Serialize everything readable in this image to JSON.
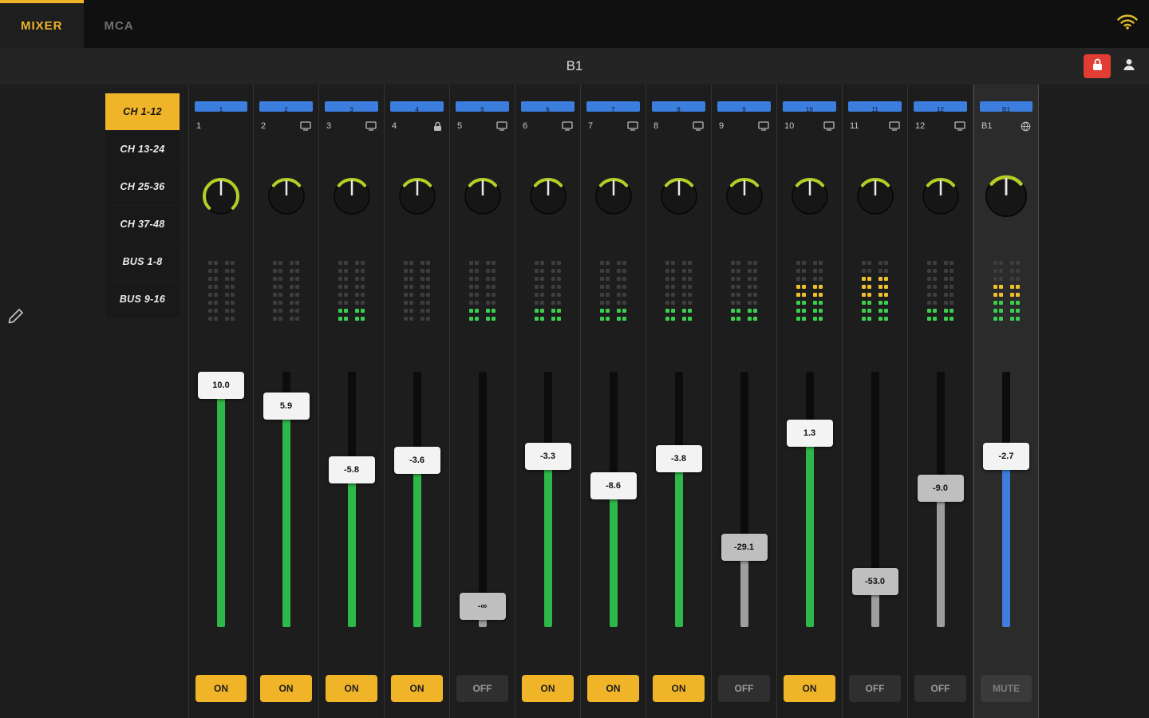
{
  "topbar": {
    "tabs": [
      {
        "label": "MIXER",
        "active": true
      },
      {
        "label": "MCA",
        "active": false
      }
    ]
  },
  "header": {
    "title": "B1"
  },
  "sidebar": {
    "items": [
      "CH 1-12",
      "CH 13-24",
      "CH 25-36",
      "CH 37-48",
      "BUS 1-8",
      "BUS 9-16"
    ],
    "active_index": 0
  },
  "colors": {
    "accent_yellow": "#f0b429",
    "channel_blue": "#3c7ede",
    "knob_arc": "#b6cd28",
    "fader_green": "#2eb84a",
    "fader_gray": "#9e9e9e",
    "fader_blue": "#3d7edb",
    "meter_green": "#3ccf4e",
    "meter_yellow": "#eec02c",
    "meter_off": "#3d3d3d",
    "alert_red": "#e23d32"
  },
  "channels": [
    {
      "id": "1",
      "icon": null,
      "knob_arc": 270,
      "meter_green": 0,
      "meter_yellow": 0,
      "fader_value": "10.0",
      "fader_pos": 1.0,
      "state": "ON",
      "fill": "green",
      "master": false
    },
    {
      "id": "2",
      "icon": "monitor",
      "knob_arc": 100,
      "meter_green": 0,
      "meter_yellow": 0,
      "fader_value": "5.9",
      "fader_pos": 0.91,
      "state": "ON",
      "fill": "green",
      "master": false
    },
    {
      "id": "3",
      "icon": "monitor",
      "knob_arc": 100,
      "meter_green": 2,
      "meter_yellow": 0,
      "fader_value": "-5.8",
      "fader_pos": 0.63,
      "state": "ON",
      "fill": "green",
      "master": false
    },
    {
      "id": "4",
      "icon": "lock",
      "knob_arc": 100,
      "meter_green": 0,
      "meter_yellow": 0,
      "fader_value": "-3.6",
      "fader_pos": 0.67,
      "state": "ON",
      "fill": "green",
      "master": false
    },
    {
      "id": "5",
      "icon": "monitor",
      "knob_arc": 100,
      "meter_green": 2,
      "meter_yellow": 0,
      "fader_value": "-∞",
      "fader_pos": 0.03,
      "state": "OFF",
      "fill": "gray",
      "master": false
    },
    {
      "id": "6",
      "icon": "monitor",
      "knob_arc": 100,
      "meter_green": 2,
      "meter_yellow": 0,
      "fader_value": "-3.3",
      "fader_pos": 0.69,
      "state": "ON",
      "fill": "green",
      "master": false
    },
    {
      "id": "7",
      "icon": "monitor",
      "knob_arc": 100,
      "meter_green": 2,
      "meter_yellow": 0,
      "fader_value": "-8.6",
      "fader_pos": 0.56,
      "state": "ON",
      "fill": "green",
      "master": false
    },
    {
      "id": "8",
      "icon": "monitor",
      "knob_arc": 100,
      "meter_green": 2,
      "meter_yellow": 0,
      "fader_value": "-3.8",
      "fader_pos": 0.68,
      "state": "ON",
      "fill": "green",
      "master": false
    },
    {
      "id": "9",
      "icon": "monitor",
      "knob_arc": 100,
      "meter_green": 2,
      "meter_yellow": 0,
      "fader_value": "-29.1",
      "fader_pos": 0.29,
      "state": "OFF",
      "fill": "gray",
      "master": false
    },
    {
      "id": "10",
      "icon": "monitor",
      "knob_arc": 100,
      "meter_green": 3,
      "meter_yellow": 2,
      "fader_value": "1.3",
      "fader_pos": 0.79,
      "state": "ON",
      "fill": "green",
      "master": false
    },
    {
      "id": "11",
      "icon": "monitor",
      "knob_arc": 100,
      "meter_green": 3,
      "meter_yellow": 3,
      "fader_value": "-53.0",
      "fader_pos": 0.14,
      "state": "OFF",
      "fill": "gray",
      "master": false
    },
    {
      "id": "12",
      "icon": "monitor",
      "knob_arc": 100,
      "meter_green": 2,
      "meter_yellow": 0,
      "fader_value": "-9.0",
      "fader_pos": 0.55,
      "state": "OFF",
      "fill": "gray",
      "master": false
    },
    {
      "id": "B1",
      "icon": "globe",
      "knob_arc": 100,
      "meter_green": 3,
      "meter_yellow": 2,
      "fader_value": "-2.7",
      "fader_pos": 0.69,
      "state": "MUTE",
      "fill": "blue",
      "master": true
    }
  ]
}
